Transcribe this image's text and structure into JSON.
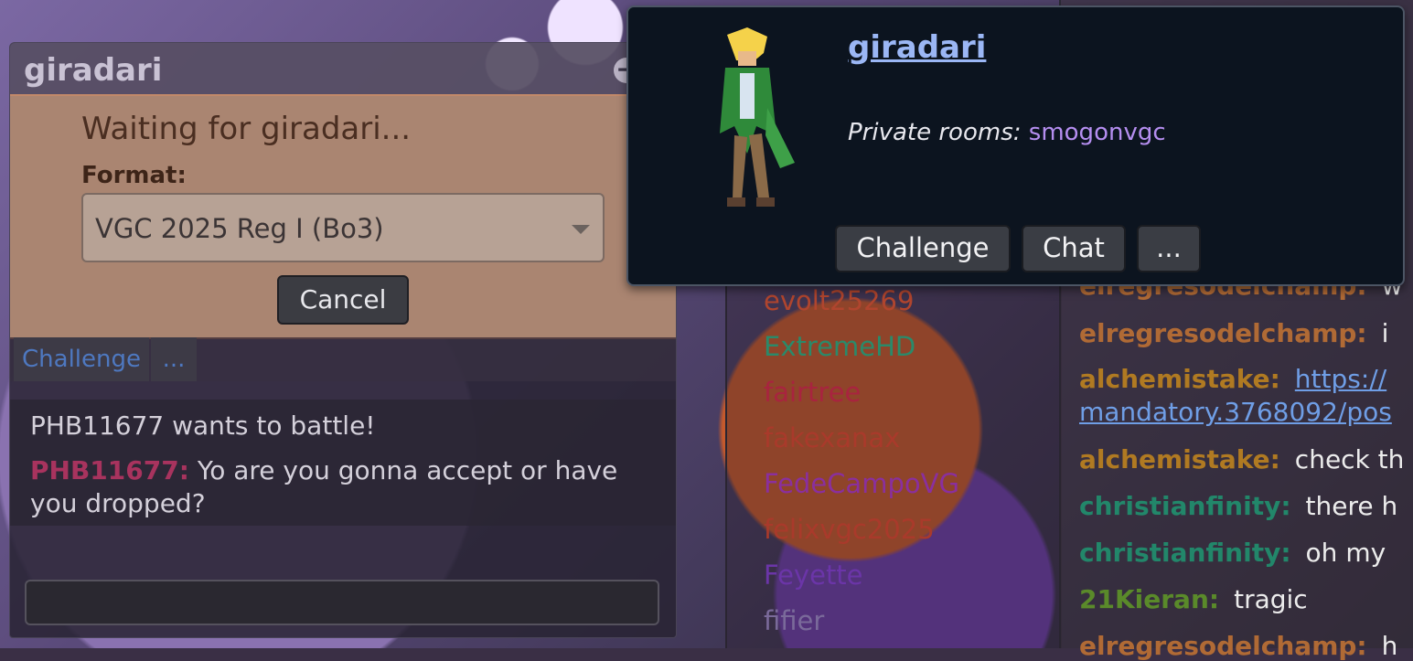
{
  "popup": {
    "title": "giradari",
    "minimize_label": "−",
    "waiting_text": "Waiting for giradari...",
    "format_label": "Format:",
    "format_value": "VGC 2025 Reg I (Bo3)",
    "cancel_label": "Cancel",
    "tabs": {
      "challenge": "Challenge",
      "more": "..."
    },
    "messages": {
      "system": "PHB11677 wants to battle!",
      "user": "PHB11677:",
      "text": "Yo are you gonna accept or have you dropped?"
    },
    "input_value": ""
  },
  "userlist": [
    {
      "name": "evolt25269",
      "color": "#b0452e"
    },
    {
      "name": "ExtremeHD",
      "color": "#2a8a6a"
    },
    {
      "name": "fairtree",
      "color": "#a8243f"
    },
    {
      "name": "fakexanax",
      "color": "#a93a2b"
    },
    {
      "name": "FedeCampoVG",
      "color": "#8a2f9e"
    },
    {
      "name": "felixvgc2025",
      "color": "#a93a2b"
    },
    {
      "name": "Feyette",
      "color": "#6b35a8"
    },
    {
      "name": "fifier",
      "color": "#7a6a9a"
    }
  ],
  "chat": [
    {
      "user": "elregresodelchamp:",
      "text": "w",
      "color": "#b06a35"
    },
    {
      "user": "elregresodelchamp:",
      "text": "i",
      "color": "#b06a35"
    },
    {
      "user": "alchemistake:",
      "link1": "https://",
      "link2": "mandatory.3768092/pos",
      "color": "#b07a22"
    },
    {
      "user": "alchemistake:",
      "text": "check th",
      "color": "#b07a22"
    },
    {
      "user": "christianfinity:",
      "text": "there h",
      "color": "#22876a"
    },
    {
      "user": "christianfinity:",
      "text": "oh my",
      "color": "#22876a"
    },
    {
      "user": "21Kieran:",
      "text": "tragic",
      "color": "#5a8a2a"
    },
    {
      "user": "elregresodelchamp:",
      "text": "h",
      "color": "#b06a35"
    }
  ],
  "profile": {
    "name": "giradari",
    "rooms_label": "Private rooms:",
    "room": "smogonvgc",
    "buttons": {
      "challenge": "Challenge",
      "chat": "Chat",
      "more": "..."
    }
  }
}
